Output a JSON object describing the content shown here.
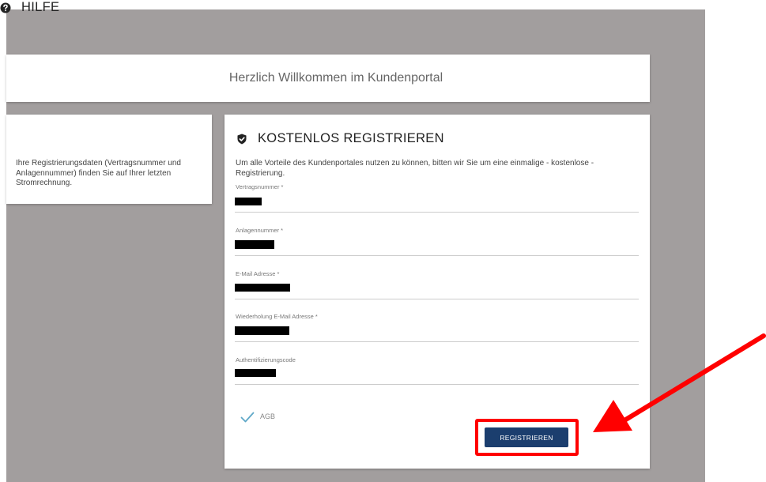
{
  "header": {
    "welcome": "Herzlich Willkommen im Kundenportal"
  },
  "help": {
    "title": "HILFE",
    "text": "Ihre Registrierungsdaten (Vertragsnummer und Anlagennummer) finden Sie auf Ihrer letzten Stromrechnung."
  },
  "register": {
    "title": "KOSTENLOS REGISTRIEREN",
    "intro": "Um alle Vorteile des Kundenportales nutzen zu können, bitten wir Sie um eine einmalige - kostenlose - Registrierung.",
    "fields": [
      {
        "label": "Vertragsnummer *"
      },
      {
        "label": "Anlagennummer *"
      },
      {
        "label": "E-Mail Adresse *"
      },
      {
        "label": "Wiederholung E-Mail Adresse *"
      },
      {
        "label": "Authentifizierungscode"
      }
    ],
    "agb_label": "AGB",
    "agb_checked": true,
    "submit_label": "REGISTRIEREN"
  },
  "colors": {
    "background": "#a29e9e",
    "button": "#1b3e6e",
    "highlight": "#ff0000",
    "checkmark": "#5fa8c8"
  },
  "icons": {
    "help": "question-circle-icon",
    "register": "shield-check-icon",
    "agb": "checkmark-icon",
    "annotation": "red-arrow-annotation"
  }
}
